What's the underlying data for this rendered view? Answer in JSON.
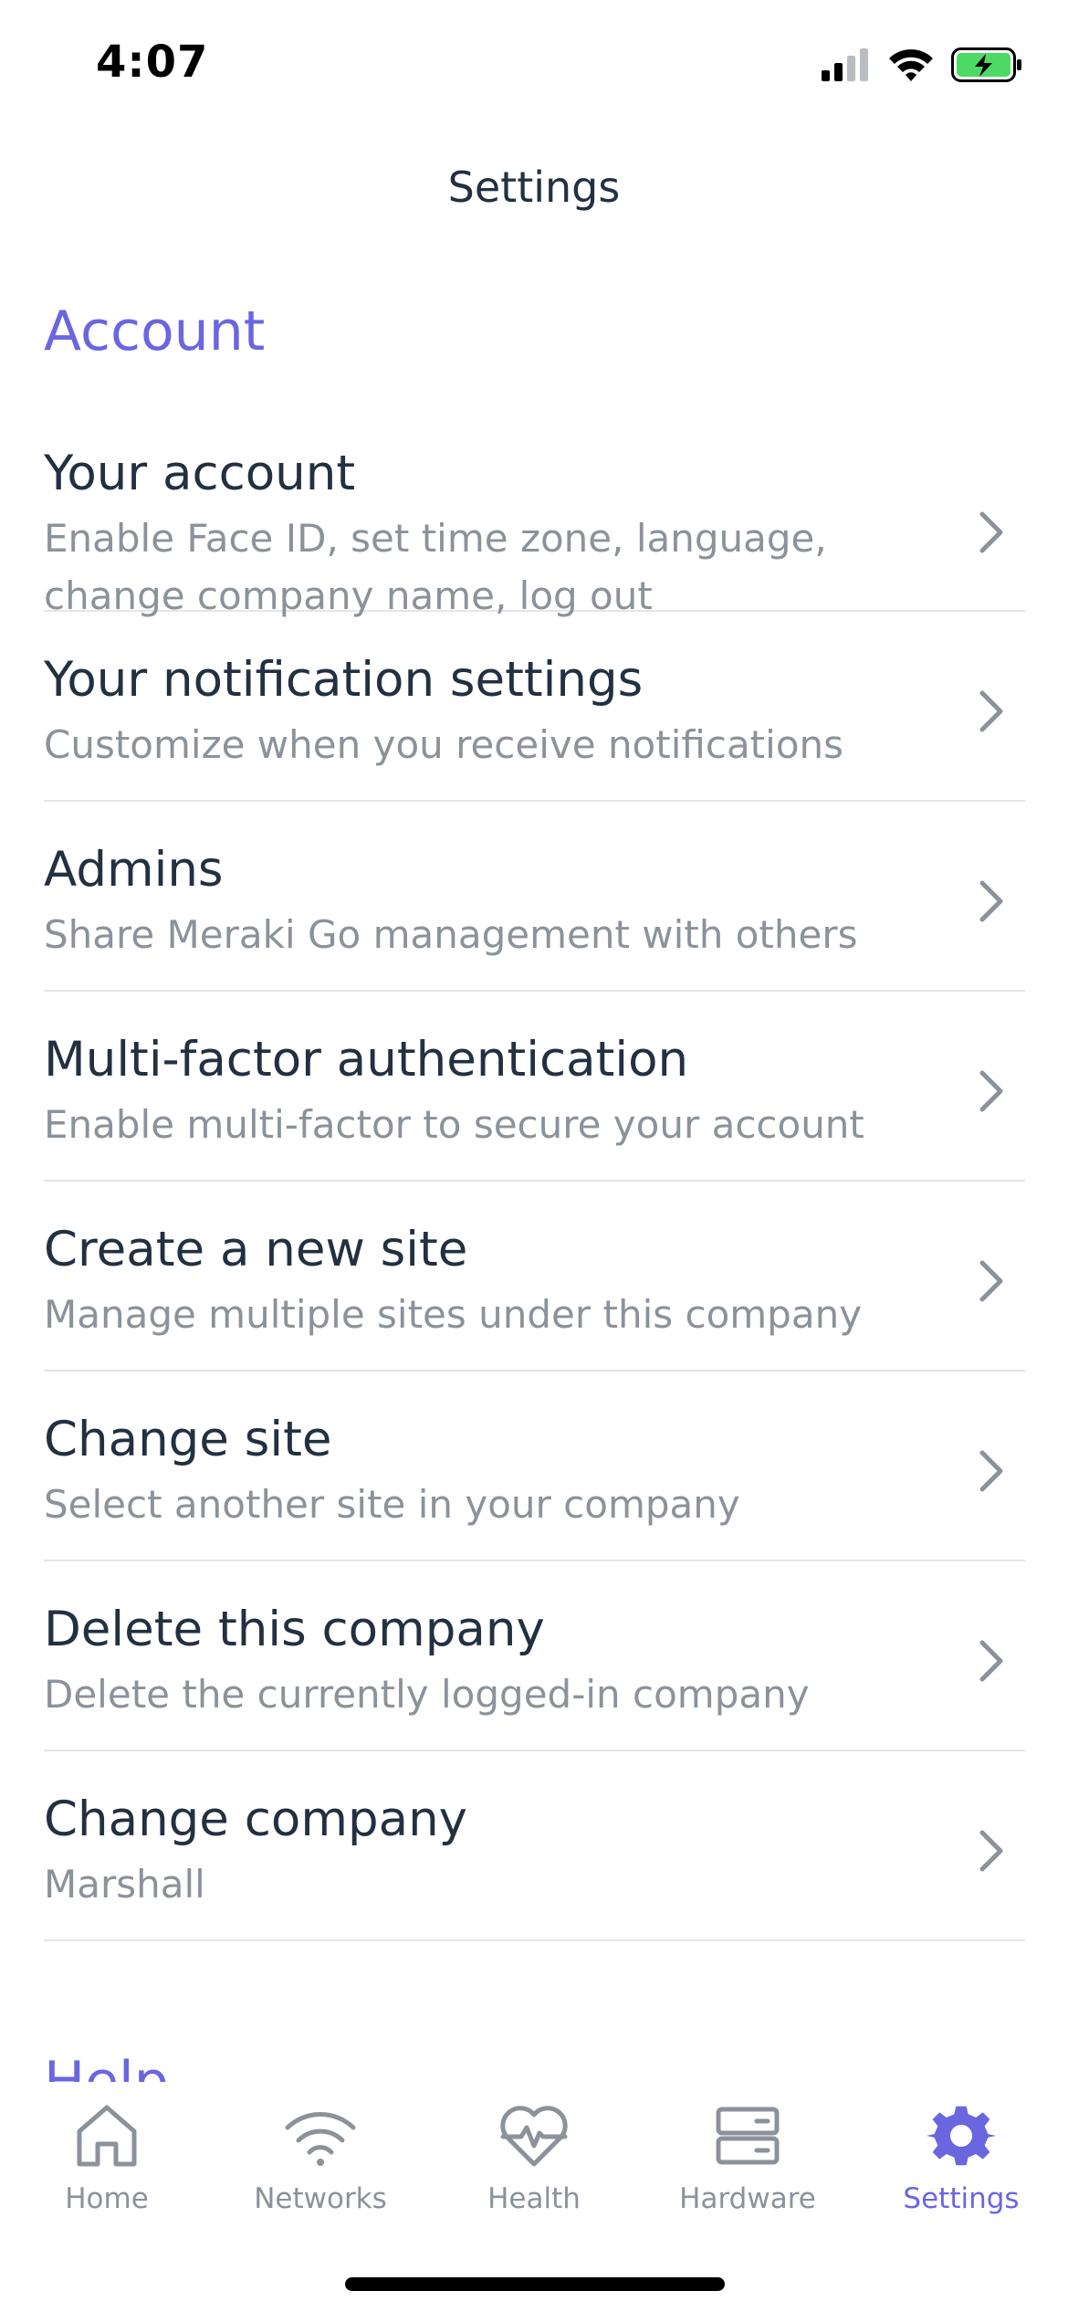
{
  "status_bar": {
    "time": "4:07"
  },
  "nav": {
    "title": "Settings"
  },
  "sections": {
    "account_header": "Account",
    "help_header": "Help"
  },
  "rows": [
    {
      "title": "Your account",
      "subtitle": "Enable Face ID, set time zone, language,\nchange company name, log out"
    },
    {
      "title": "Your notification settings",
      "subtitle": "Customize when you receive notifications"
    },
    {
      "title": "Admins",
      "subtitle": "Share Meraki Go management with others"
    },
    {
      "title": "Multi-factor authentication",
      "subtitle": "Enable multi-factor to secure your account"
    },
    {
      "title": "Create a new site",
      "subtitle": "Manage multiple sites under this company"
    },
    {
      "title": "Change site",
      "subtitle": "Select another site in your company"
    },
    {
      "title": "Delete this company",
      "subtitle": "Delete the currently logged-in company"
    },
    {
      "title": "Change company",
      "subtitle": "Marshall"
    }
  ],
  "tabs": [
    {
      "label": "Home",
      "icon": "home-icon"
    },
    {
      "label": "Networks",
      "icon": "wifi-icon"
    },
    {
      "label": "Health",
      "icon": "heart-pulse-icon"
    },
    {
      "label": "Hardware",
      "icon": "server-icon"
    },
    {
      "label": "Settings",
      "icon": "gear-icon",
      "active": true
    }
  ],
  "colors": {
    "accent": "#6a66e0",
    "text_primary": "#233040",
    "text_secondary": "#8c929a",
    "divider": "#e3e5e8",
    "battery_green": "#4cd964"
  }
}
